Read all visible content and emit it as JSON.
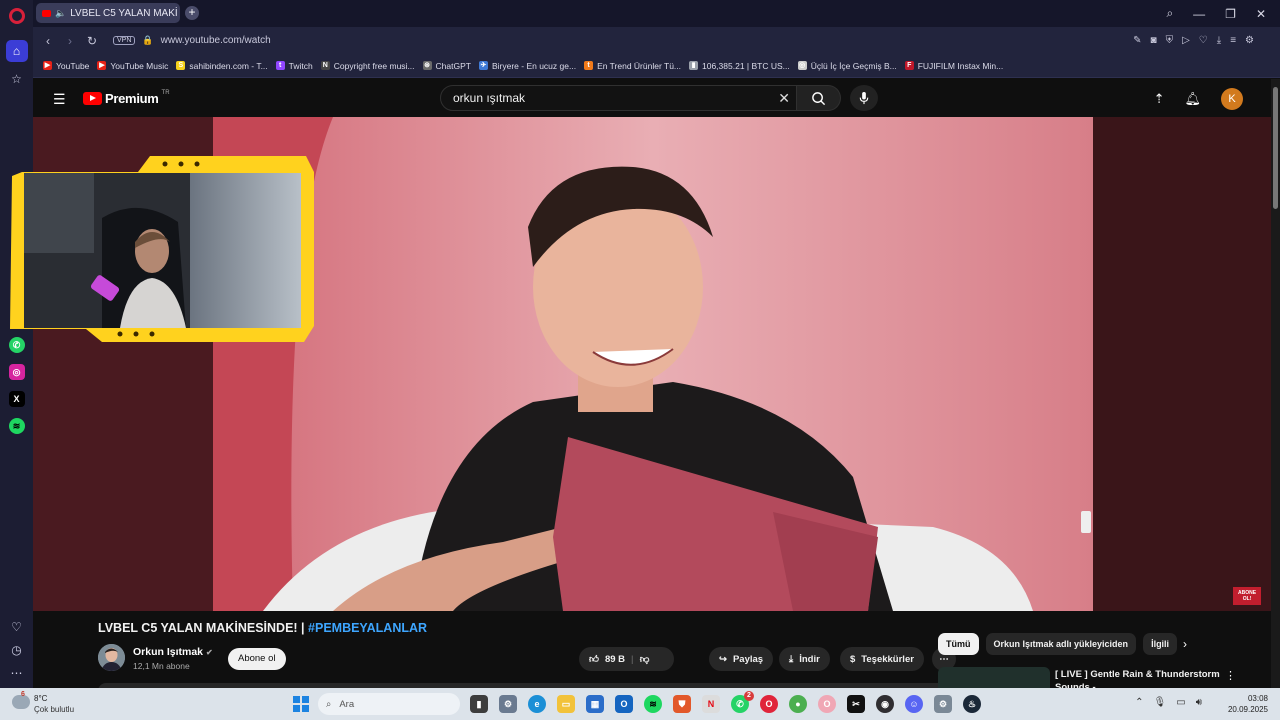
{
  "browser": {
    "tab_title": "LVBEL C5 YALAN MAKİ",
    "url": "www.youtube.com/watch",
    "vpn_label": "VPN",
    "bookmarks": [
      {
        "label": "YouTube",
        "color": "#e62117",
        "glyph": "▶"
      },
      {
        "label": "YouTube Music",
        "color": "#e62117",
        "glyph": "▶"
      },
      {
        "label": "sahibinden.com - T...",
        "color": "#f5d11b",
        "glyph": "S"
      },
      {
        "label": "Twitch",
        "color": "#9146ff",
        "glyph": "t"
      },
      {
        "label": "Copyright free musi...",
        "color": "#444444",
        "glyph": "N"
      },
      {
        "label": "ChatGPT",
        "color": "#6b6b6b",
        "glyph": "⊛"
      },
      {
        "label": "Biryere - En ucuz ge...",
        "color": "#3f7ad6",
        "glyph": "✈"
      },
      {
        "label": "En Trend Ürünler Tü...",
        "color": "#f27a1a",
        "glyph": "t"
      },
      {
        "label": "106,385.21 | BTC US...",
        "color": "#9aa0aa",
        "glyph": "▮"
      },
      {
        "label": "Üçlü İç İçe Geçmiş B...",
        "color": "#cccccc",
        "glyph": "◎"
      },
      {
        "label": "FUJIFILM Instax Min...",
        "color": "#c0172a",
        "glyph": "F"
      }
    ]
  },
  "youtube": {
    "logo_text": "Premium",
    "logo_region": "TR",
    "search_value": "orkun ışıtmak",
    "account_initial": "K",
    "video_title": "LVBEL C5 YALAN MAKİNESİNDE! |",
    "video_hashtag": "#PEMBEYALANLAR",
    "channel_name": "Orkun Işıtmak",
    "channel_subs": "12,1 Mn abone",
    "subscribe_label": "Abone ol",
    "like_count": "89 B",
    "share_label": "Paylaş",
    "download_label": "İndir",
    "thanks_label": "Teşekkürler",
    "watermark_text": "ABONE OL!",
    "chips": [
      "Tümü",
      "Orkun Işıtmak adlı yükleyiciden",
      "İlgili"
    ],
    "rec_title": "[ LIVE ] Gentle Rain & Thunderstorm Sounds -"
  },
  "taskbar": {
    "weather_temp": "8°C",
    "weather_badge": "6",
    "weather_cond": "Çok bulutlu",
    "search_placeholder": "Ara",
    "whatsapp_badge": "2",
    "time": "03:08",
    "date": "20.09.2025"
  }
}
